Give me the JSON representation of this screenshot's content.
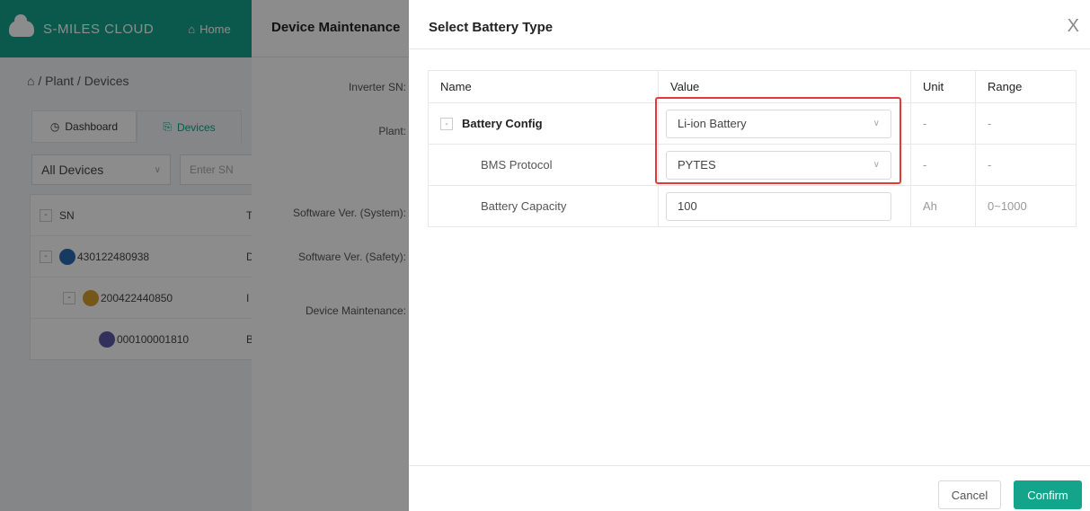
{
  "app": {
    "brand": "S-MILES CLOUD",
    "home": "Home",
    "breadcrumb": "⌂ / Plant / Devices",
    "tabs": [
      "Dashboard",
      "Devices"
    ],
    "filter_select": "All Devices",
    "sn_placeholder": "Enter SN",
    "table_header": "SN",
    "table_header_col2": "T",
    "devices": [
      {
        "sn": "430122480938",
        "col2": "D",
        "color": "#2b6cb0"
      },
      {
        "sn": "200422440850",
        "col2": "I",
        "color": "#d69e2e"
      },
      {
        "sn": "000100001810",
        "col2": "B",
        "color": "#5a5aa8"
      }
    ]
  },
  "drawer": {
    "title": "Device Maintenance",
    "labels": [
      "Inverter SN:",
      "Plant:",
      "Software Ver. (System):",
      "Software Ver. (Safety):",
      "Device Maintenance:"
    ]
  },
  "modal": {
    "title": "Select Battery Type",
    "columns": [
      "Name",
      "Value",
      "Unit",
      "Range"
    ],
    "rows": [
      {
        "name": "Battery Config",
        "value": "Li-ion Battery",
        "unit": "-",
        "range": "-"
      },
      {
        "name": "BMS Protocol",
        "value": "PYTES",
        "unit": "-",
        "range": "-"
      },
      {
        "name": "Battery Capacity",
        "value": "100",
        "unit": "Ah",
        "range": "0~1000"
      }
    ],
    "cancel": "Cancel",
    "confirm": "Confirm",
    "close": "X"
  }
}
